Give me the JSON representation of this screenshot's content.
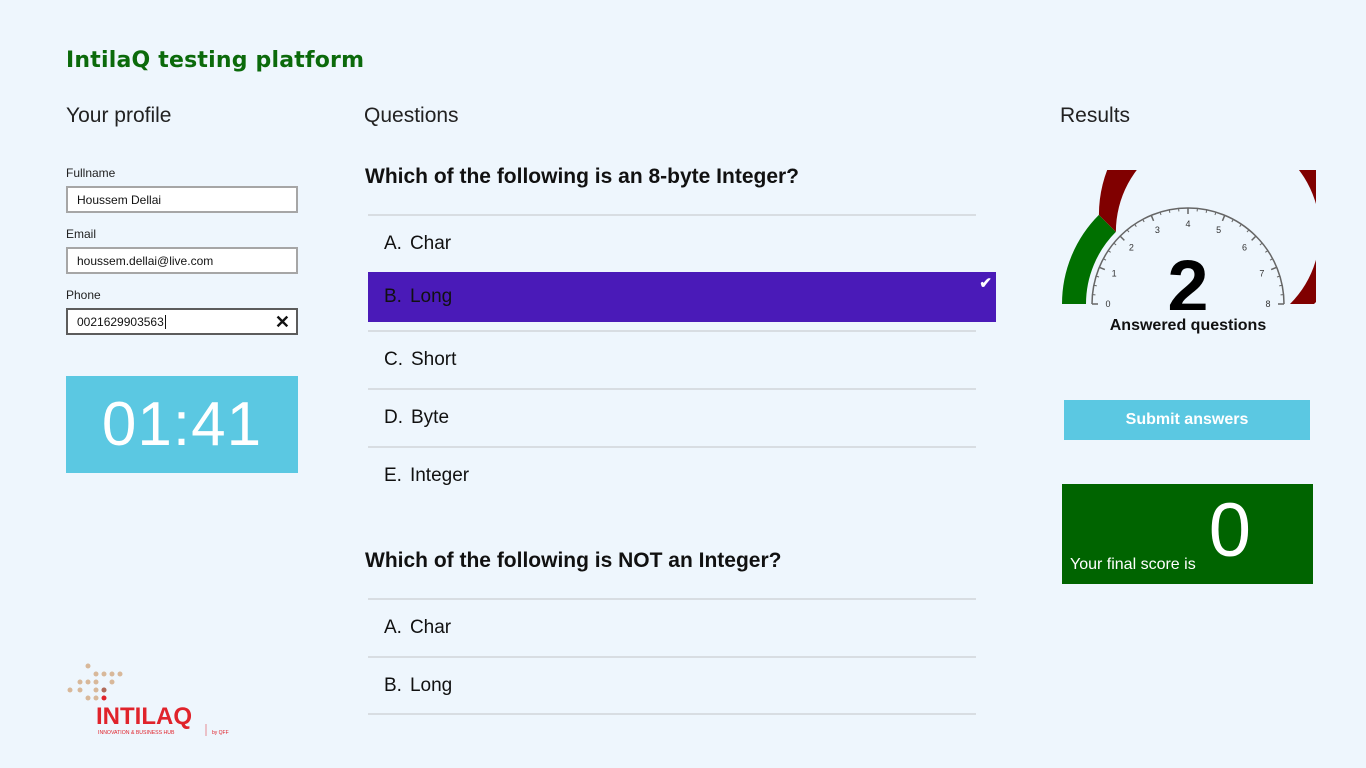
{
  "app": {
    "title": "IntilaQ testing platform"
  },
  "profile": {
    "heading": "Your profile",
    "fullname": {
      "label": "Fullname",
      "value": "Houssem Dellai"
    },
    "email": {
      "label": "Email",
      "value": "houssem.dellai@live.com"
    },
    "phone": {
      "label": "Phone",
      "value": "0021629903563"
    },
    "timer": "01:41"
  },
  "questions": {
    "heading": "Questions",
    "items": [
      {
        "text": "Which of the following is an 8-byte Integer?",
        "options": [
          {
            "letter": "A.",
            "label": "Char",
            "selected": false
          },
          {
            "letter": "B.",
            "label": "Long",
            "selected": true
          },
          {
            "letter": "C.",
            "label": "Short",
            "selected": false
          },
          {
            "letter": "D.",
            "label": "Byte",
            "selected": false
          },
          {
            "letter": "E.",
            "label": "Integer",
            "selected": false
          }
        ]
      },
      {
        "text": "Which of the following is NOT an Integer?",
        "options": [
          {
            "letter": "A.",
            "label": "Char",
            "selected": false
          },
          {
            "letter": "B.",
            "label": "Long",
            "selected": false
          }
        ]
      }
    ]
  },
  "results": {
    "heading": "Results",
    "gauge": {
      "value": 2,
      "min": 0,
      "max": 8,
      "ticks": [
        "0",
        "1",
        "2",
        "3",
        "4",
        "5",
        "6",
        "7",
        "8"
      ],
      "caption": "Answered questions",
      "colors": {
        "low": "#007000",
        "high": "#800000",
        "tick": "#666666"
      }
    },
    "submit_label": "Submit answers",
    "score_label": "Your final score is",
    "score_value": "0"
  },
  "logo": {
    "name": "INTILAQ",
    "tagline": "INNOVATION & BUSINESS HUB",
    "by": "by QFF"
  },
  "colors": {
    "accent": "#5bc8e2",
    "selected": "#4a1ab8",
    "title": "#0b6a0b",
    "score_bg": "#006400",
    "logo_red": "#e0232b"
  },
  "icons": {
    "clear": "close-icon",
    "check": "checkmark-icon"
  }
}
